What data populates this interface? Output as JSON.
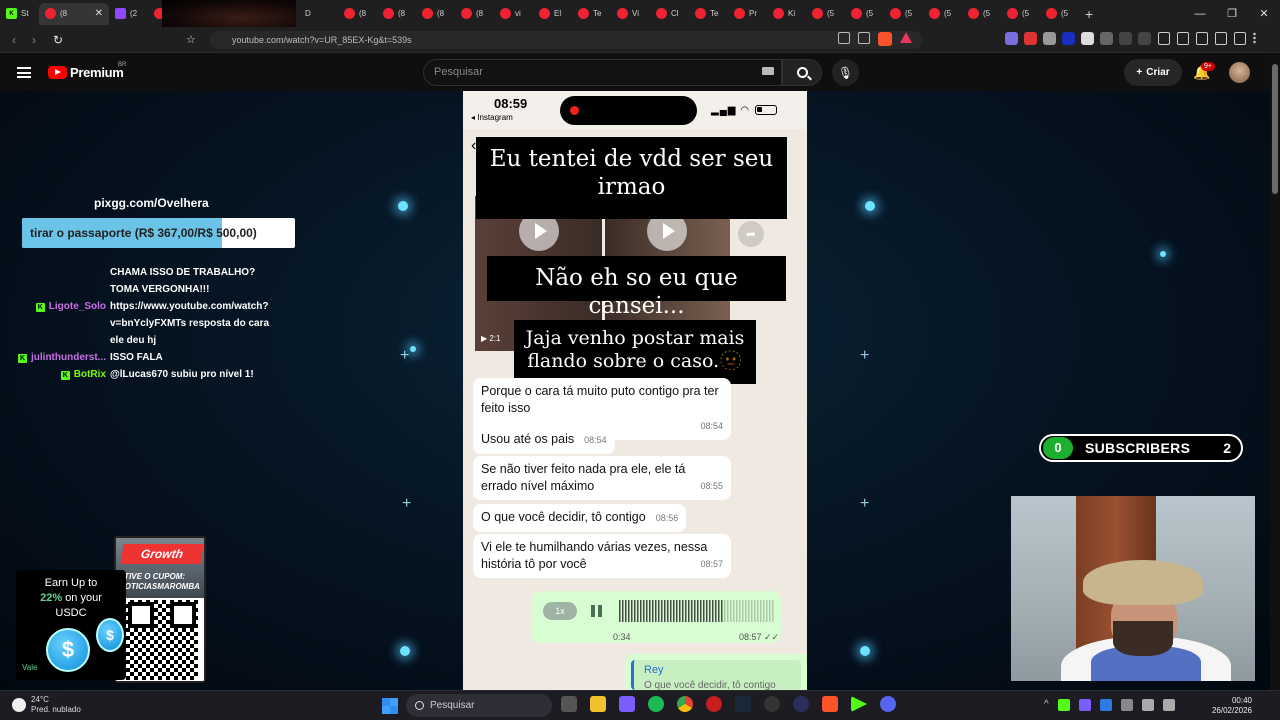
{
  "browser": {
    "active_tab": "(8",
    "tabs": [
      "St",
      "(2",
      "(8",
      "D",
      "(8",
      "(8",
      "(8",
      "(8",
      "vi",
      "El",
      "Te",
      "Vi",
      "Cl",
      "Te",
      "Pr",
      "Ki",
      "D",
      "(5",
      "(5",
      "(5",
      "(5",
      "(5",
      "(5",
      "(5"
    ],
    "url": "youtube.com/watch?v=UR_85EX-Kg&t=539s"
  },
  "youtube": {
    "brand": "Premium",
    "country": "BR",
    "search_placeholder": "Pesquisar",
    "create_label": "Criar",
    "notif_badge": "9+"
  },
  "overlay": {
    "pix_link": "pixgg.com/Ovelhera",
    "goal_label": "tirar o passaporte (R$ 367,00/R$ 500,00)",
    "goal_progress": 0.734,
    "chat": [
      {
        "user": "",
        "badge": false,
        "color": "#c76fe6",
        "msg": "CHAMA ISSO DE TRABALHO? TOMA VERGONHA!!!"
      },
      {
        "user": "Ligote_Solo",
        "badge": true,
        "color": "#c76fe6",
        "msg": "https://www.youtube.com/watch?v=bnYclyFXMTs resposta do cara ele deu hj"
      },
      {
        "user": "julinthunderst...",
        "badge": true,
        "color": "#c76fe6",
        "msg": "ISSO FALA"
      },
      {
        "user": "BotRix",
        "badge": true,
        "color": "#7cfc00",
        "msg": "@lLucas670 subiu pro nível 1!"
      }
    ],
    "subscribers": {
      "count": "0",
      "label": "SUBSCRIBERS",
      "goal": "2"
    },
    "sponsor": {
      "coupon": "ATIVE O CUPOM: NOTICIASMAROMBA",
      "logo": "Growth"
    },
    "earn_ad": {
      "line1": "Earn Up to",
      "pct": "22%",
      "line2": "on your",
      "line3": "USDC",
      "footer": "Vale"
    }
  },
  "phone": {
    "time": "08:59",
    "back_app": "◂ Instagram",
    "video_timestamp": "2:1",
    "captions": [
      "Eu tentei de vdd ser seu irmao",
      "Não eh so eu que cansei...",
      "Jaja venho postar mais flando sobre o caso.🫥"
    ],
    "messages": [
      {
        "text": "Porque o cara tá muito puto contigo pra ter feito isso",
        "time": "08:54"
      },
      {
        "text": "Usou até os pais",
        "time": "08:54"
      },
      {
        "text": "Se não tiver feito nada pra ele, ele tá errado nível máximo",
        "time": "08:55"
      },
      {
        "text": "O que você decidir, tô contigo",
        "time": "08:56"
      },
      {
        "text": "Vi ele te humilhando várias vezes, nessa história tô por você",
        "time": "08:57"
      }
    ],
    "audio": {
      "speed": "1x",
      "duration": "0:34",
      "time": "08:57 ✓✓"
    },
    "reply": {
      "name": "Rey",
      "text": "O que você decidir, tô contigo"
    }
  },
  "taskbar": {
    "temp": "24°C",
    "weather": "Pred. nublado",
    "search": "Pesquisar",
    "time": "00:40",
    "date": "26/02/2026"
  }
}
